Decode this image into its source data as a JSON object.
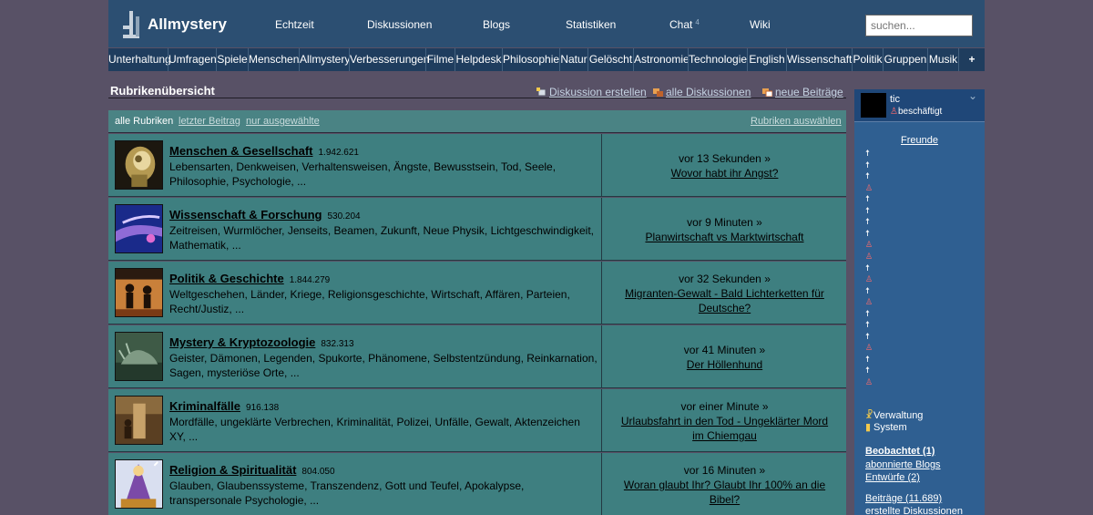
{
  "header": {
    "logo": "Allmystery",
    "nav": [
      "Echtzeit",
      "Diskussionen",
      "Blogs",
      "Statistiken",
      "Chat",
      "Wiki"
    ],
    "chat_badge": "4",
    "search_placeholder": "suchen..."
  },
  "categories": [
    "Unterhaltung",
    "Umfragen",
    "Spiele",
    "Menschen",
    "Allmystery",
    "Verbesserungen",
    "Filme",
    "Helpdesk",
    "Philosophie",
    "Natur",
    "Gelöscht",
    "Astronomie",
    "Technologie",
    "English",
    "Wissenschaft",
    "Politik",
    "Gruppen",
    "Musik",
    "+"
  ],
  "main": {
    "title": "Rubrikenübersicht",
    "actions": [
      "Diskussion erstellen",
      "alle Diskussionen",
      "neue Beiträge"
    ],
    "tabs": {
      "active": "alle Rubriken",
      "latest": "letzter Beitrag",
      "selected": "nur ausgewählte",
      "choose": "Rubriken auswählen"
    },
    "rubriken": [
      {
        "title": "Menschen & Gesellschaft",
        "count": "1.942.621",
        "desc": "Lebensarten, Denkweisen, Verhaltensweisen, Ängste, Bewusstsein, Tod, Seele, Philosophie, Psychologie, ...",
        "time": "vor 13 Sekunden »",
        "link": "Wovor habt ihr Angst?"
      },
      {
        "title": "Wissenschaft & Forschung",
        "count": "530.204",
        "desc": "Zeitreisen, Wurmlöcher, Jenseits, Beamen, Zukunft, Neue Physik, Lichtgeschwindigkeit, Mathematik, ...",
        "time": "vor 9 Minuten »",
        "link": "Planwirtschaft vs Marktwirtschaft"
      },
      {
        "title": "Politik & Geschichte",
        "count": "1.844.279",
        "desc": "Weltgeschehen, Länder, Kriege, Religionsgeschichte, Wirtschaft, Affären, Parteien, Recht/Justiz, ...",
        "time": "vor 32 Sekunden »",
        "link": "Migranten-Gewalt - Bald Lichterketten für Deutsche?"
      },
      {
        "title": "Mystery & Kryptozoologie",
        "count": "832.313",
        "desc": "Geister, Dämonen, Legenden, Spukorte, Phänomene, Selbstentzündung, Reinkarnation, Sagen, mysteriöse Orte, ...",
        "time": "vor 41 Minuten »",
        "link": "Der Höllenhund"
      },
      {
        "title": "Kriminalfälle",
        "count": "916.138",
        "desc": "Mordfälle, ungeklärte Verbrechen, Kriminalität, Polizei, Unfälle, Gewalt, Aktenzeichen XY, ...",
        "time": "vor einer Minute »",
        "link": "Urlaubsfahrt in den Tod - Ungeklärter Mord im Chiemgau"
      },
      {
        "title": "Religion & Spiritualität",
        "count": "804.050",
        "desc": "Glauben, Glaubenssysteme, Transzendenz, Gott und Teufel, Apokalypse, transpersonale Psychologie, ...",
        "time": "vor 16 Minuten »",
        "link": "Woran glaubt Ihr? Glaubt Ihr 100% an die Bibel?"
      }
    ]
  },
  "sidebar": {
    "username": "tic",
    "status": "beschäftigt",
    "friends_label": "Freunde",
    "friends_status": [
      "online",
      "online",
      "online",
      "busy",
      "online",
      "online",
      "online",
      "online",
      "busy",
      "busy",
      "online",
      "busy",
      "online",
      "busy",
      "online",
      "online",
      "online",
      "busy",
      "online",
      "online",
      "busy"
    ],
    "verwaltung": "Verwaltung",
    "system": "System",
    "beobachtet": "Beobachtet (1)",
    "abonnierte_blogs": "abonnierte Blogs",
    "entwuerfe": "Entwürfe (2)",
    "beitraege": "Beiträge (11.689)",
    "erstellte": "erstellte Diskussionen"
  }
}
